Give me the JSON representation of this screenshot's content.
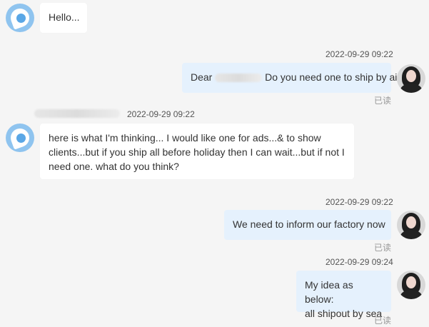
{
  "messages": [
    {
      "from": "buyer",
      "text": "Hello..."
    },
    {
      "from": "agent",
      "time": "2022-09-29 09:22",
      "text_prefix": "Dear ",
      "text_suffix": " Do you need one to ship by air ?",
      "status": "已读"
    },
    {
      "from": "buyer",
      "time": "2022-09-29 09:22",
      "lines": [
        "here is what I'm thinking... I would like one for ads...& to show",
        "clients...but if you ship all before holiday then I can wait...but if not I",
        "need one. what do you think?"
      ]
    },
    {
      "from": "agent",
      "time": "2022-09-29 09:22",
      "text": "We need to inform our factory now",
      "status": "已读"
    },
    {
      "from": "agent",
      "time": "2022-09-29 09:24",
      "lines": [
        "My idea as below:",
        "all shipout by sea"
      ],
      "status": "已读"
    }
  ],
  "colors": {
    "page_bg": "#f5f5f5",
    "incoming_bubble": "#ffffff",
    "outgoing_bubble": "#e5f1fd",
    "read_text": "#999999"
  }
}
